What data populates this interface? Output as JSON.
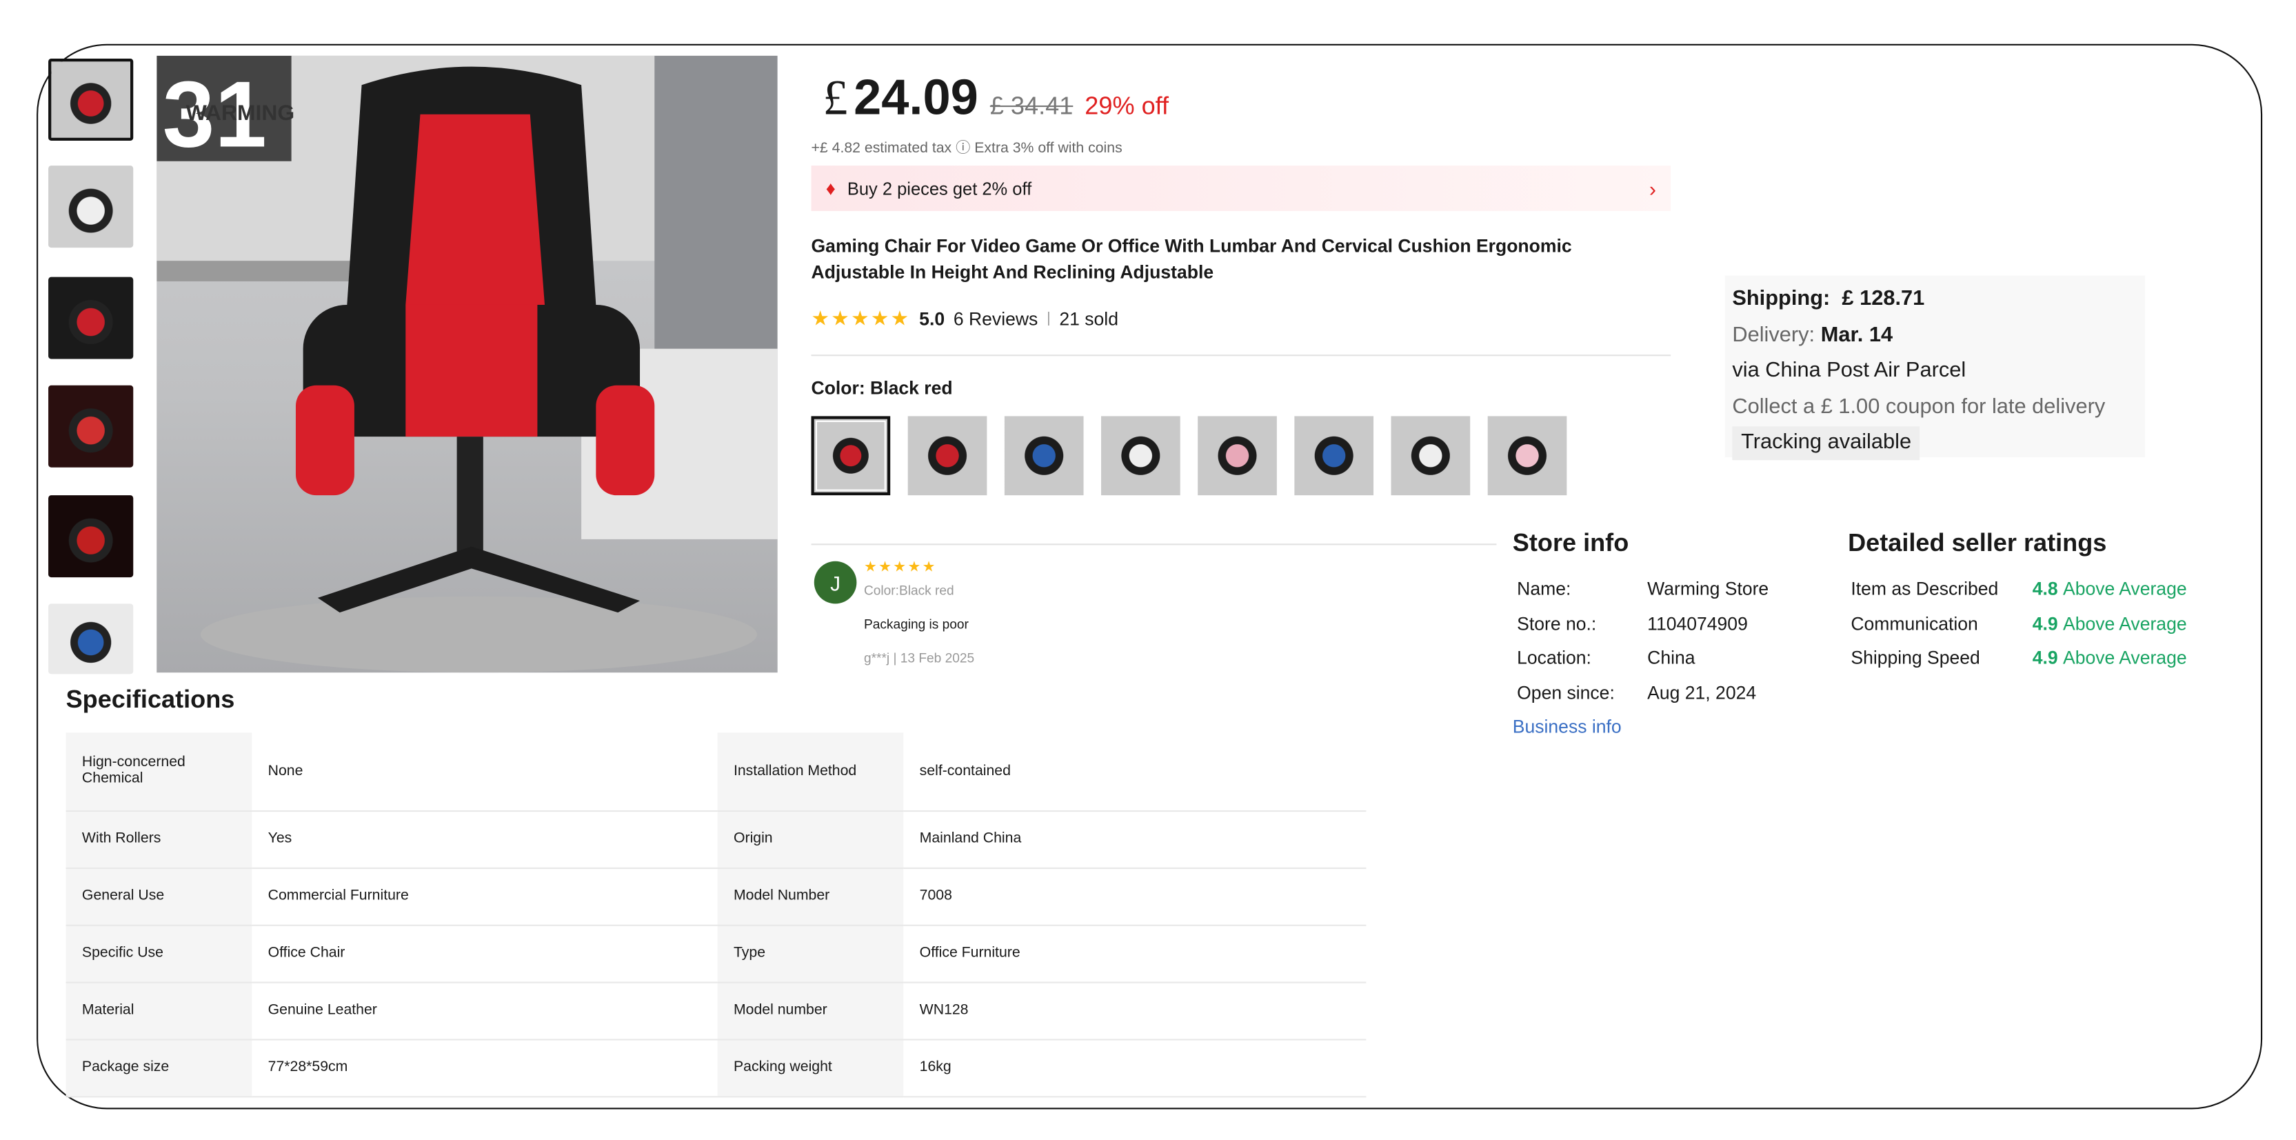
{
  "colors": {
    "accent_red": "#e02020",
    "star": "#fdb913",
    "green": "#19a463",
    "link": "#3a6fc4",
    "avatar": "#336e2d"
  },
  "gallery": {
    "thumb_count": 6,
    "selected_index": 0,
    "main_image_logo": "WARMING STORE",
    "badge": "31"
  },
  "price": {
    "currency": "£",
    "current": "24.09",
    "original": "£ 34.41",
    "discount": "29% off",
    "tax": "+£ 4.82 estimated tax",
    "coins": "Extra 3% off with coins"
  },
  "promo": {
    "icon": "tag-icon",
    "text": "Buy 2 pieces get 2% off"
  },
  "product": {
    "title": "Gaming Chair For Video Game Or Office With Lumbar And Cervical Cushion Ergonomic Adjustable In Height And Reclining Adjustable",
    "rating": "5.0",
    "reviews": "6 Reviews",
    "sold": "21 sold",
    "stars": 5
  },
  "color": {
    "label": "Color: Black red",
    "swatches": [
      "black-red",
      "black-red",
      "blue",
      "black-white",
      "pink",
      "blue-black",
      "black-white",
      "pink-white"
    ],
    "selected_index": 0
  },
  "review": {
    "avatar_letter": "J",
    "stars": 5,
    "variant": "Color:Black red",
    "text": "Packaging is poor",
    "meta": "g***j | 13 Feb 2025"
  },
  "shipping": {
    "label": "Shipping:",
    "cost": "£ 128.71",
    "delivery_label": "Delivery:",
    "delivery_date": "Mar. 14",
    "via": "via China Post Air Parcel",
    "coupon": "Collect a  £ 1.00 coupon for late delivery",
    "tracking": "Tracking available"
  },
  "store": {
    "title": "Store info",
    "rows": [
      {
        "k": "Name:",
        "v": "Warming Store"
      },
      {
        "k": "Store no.:",
        "v": "1104074909"
      },
      {
        "k": "Location:",
        "v": "China"
      },
      {
        "k": "Open since:",
        "v": "Aug 21, 2024"
      }
    ],
    "link": "Business info"
  },
  "ratings": {
    "title": "Detailed seller ratings",
    "rows": [
      {
        "k": "Item as Described",
        "score": "4.8",
        "label": "Above Average"
      },
      {
        "k": "Communication",
        "score": "4.9",
        "label": "Above Average"
      },
      {
        "k": "Shipping Speed",
        "score": "4.9",
        "label": "Above Average"
      }
    ]
  },
  "specs": {
    "title": "Specifications",
    "rows": [
      [
        "Hign-concerned Chemical",
        "None",
        "Installation Method",
        "self-contained"
      ],
      [
        "With Rollers",
        "Yes",
        "Origin",
        "Mainland China"
      ],
      [
        "General Use",
        "Commercial Furniture",
        "Model Number",
        "7008"
      ],
      [
        "Specific Use",
        "Office Chair",
        "Type",
        "Office Furniture"
      ],
      [
        "Material",
        "Genuine Leather",
        "Model number",
        "WN128"
      ],
      [
        "Package size",
        "77*28*59cm",
        "Packing weight",
        "16kg"
      ]
    ]
  }
}
